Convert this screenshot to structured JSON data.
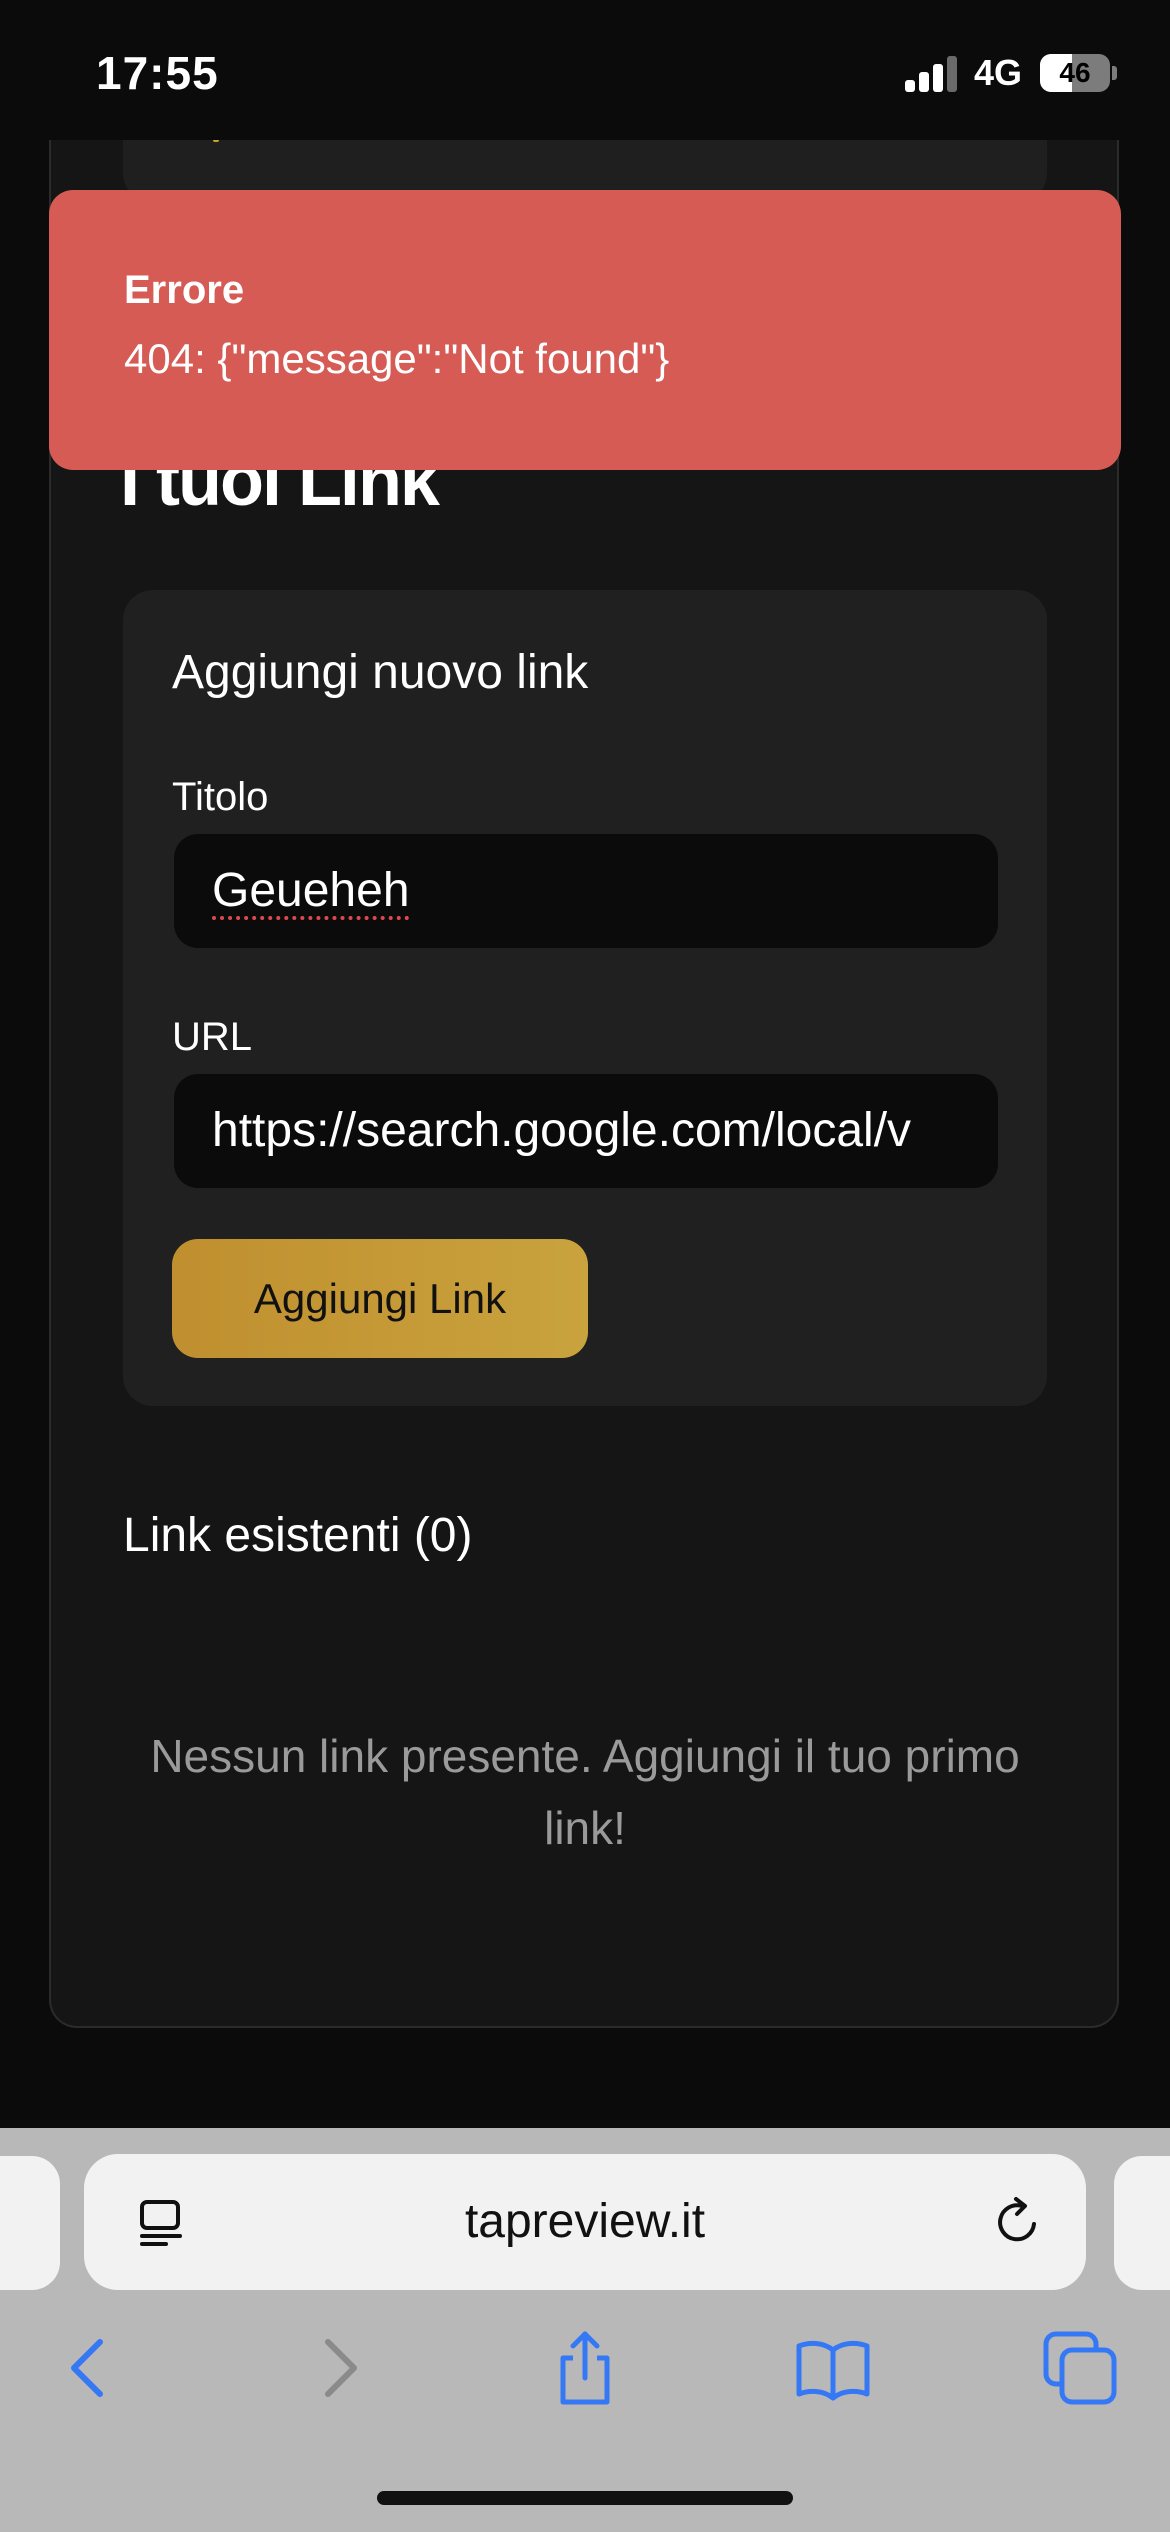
{
  "status_bar": {
    "time": "17:55",
    "network": "4G",
    "battery": "46",
    "battery_level": 0.46
  },
  "page": {
    "title": "I tuoi Link",
    "add_card": {
      "heading": "Aggiungi nuovo link",
      "title_label": "Titolo",
      "title_value": "Geueheh",
      "url_label": "URL",
      "url_value": "https://search.google.com/local/v",
      "submit_label": "Aggiungi Link"
    },
    "existing_heading": "Link esistenti (0)",
    "empty_message": "Nessun link presente. Aggiungi il tuo primo link!"
  },
  "toast": {
    "title": "Errore",
    "message": "404: {\"message\":\"Not found\"}",
    "color": "#d65b55"
  },
  "browser": {
    "address": "tapreview.it",
    "accent_color": "#3478f6"
  }
}
